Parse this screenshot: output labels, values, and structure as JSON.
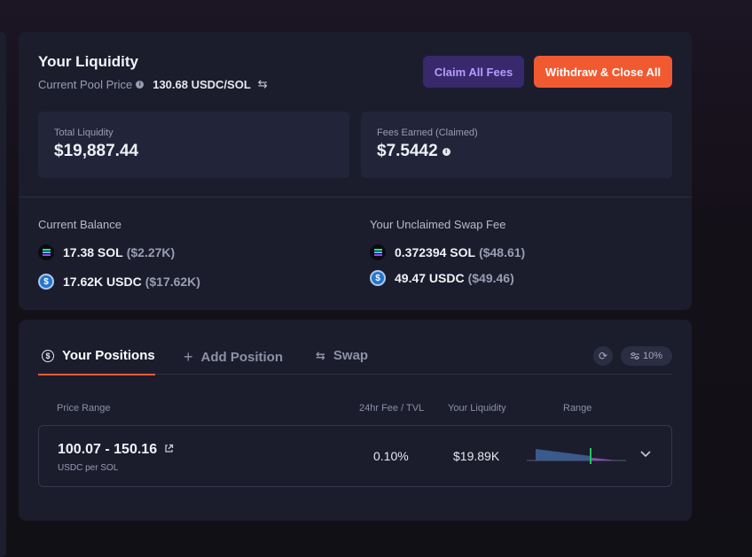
{
  "liquidity": {
    "title": "Your Liquidity",
    "pool_price_label": "Current Pool Price",
    "pool_price_value": "130.68 USDC/SOL",
    "claim_button": "Claim All Fees",
    "withdraw_button": "Withdraw & Close All",
    "total_liquidity_label": "Total Liquidity",
    "total_liquidity_value": "$19,887.44",
    "fees_earned_label": "Fees Earned (Claimed)",
    "fees_earned_value": "$7.5442"
  },
  "balance": {
    "title": "Current Balance",
    "items": [
      {
        "amount": "17.38 SOL",
        "usd": "($2.27K)",
        "icon": "solana-icon"
      },
      {
        "amount": "17.62K USDC",
        "usd": "($17.62K)",
        "icon": "usdc-icon"
      }
    ]
  },
  "unclaimed": {
    "title": "Your Unclaimed Swap Fee",
    "items": [
      {
        "amount": "0.372394 SOL",
        "usd": "($48.61)",
        "icon": "solana-icon"
      },
      {
        "amount": "49.47 USDC",
        "usd": "($49.46)",
        "icon": "usdc-icon"
      }
    ]
  },
  "tabs": [
    {
      "label": "Your Positions",
      "active": true,
      "icon": "dollar-circle-icon"
    },
    {
      "label": "Add Position",
      "active": false,
      "icon": "plus-icon"
    },
    {
      "label": "Swap",
      "active": false,
      "icon": "swap-icon"
    }
  ],
  "slippage": "10%",
  "table": {
    "headers": [
      "Price Range",
      "24hr Fee / TVL",
      "Your Liquidity",
      "Range"
    ],
    "rows": [
      {
        "range": "100.07 - 150.16",
        "unit": "USDC per SOL",
        "fee_tvl": "0.10%",
        "liquidity": "$19.89K"
      }
    ]
  },
  "colors": {
    "accent": "#f15a31",
    "claim_bg": "#37296b",
    "claim_text": "#b69bff",
    "card_bg": "#1b1d2d",
    "range_left": "#3a5a8c",
    "range_right": "#8a4fb0",
    "range_marker": "#22c55e"
  }
}
